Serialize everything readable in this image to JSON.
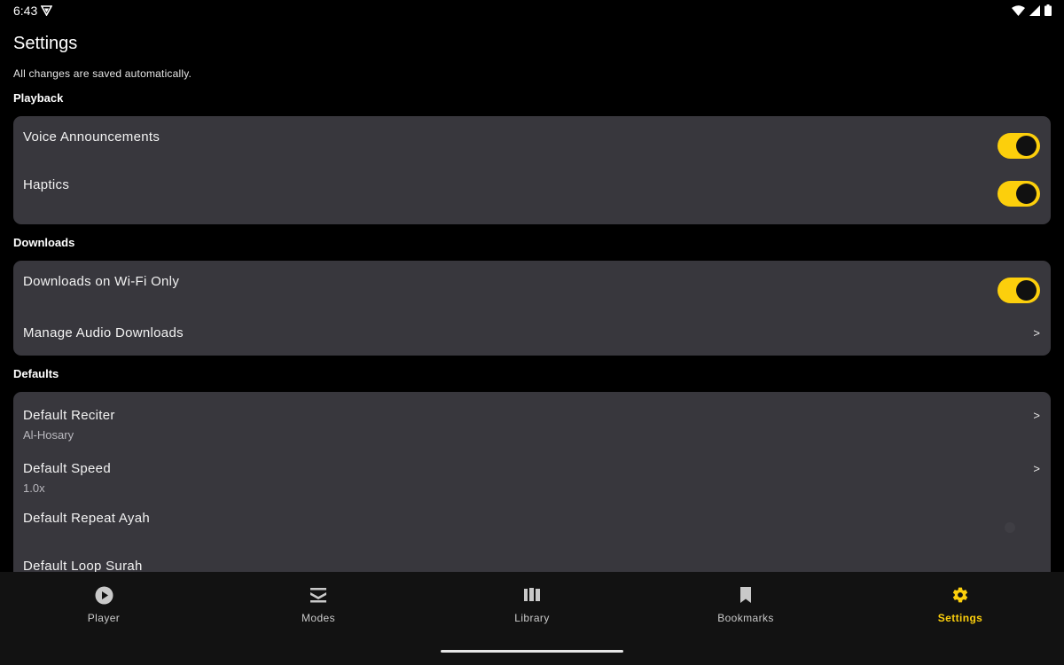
{
  "status_bar": {
    "time": "6:43"
  },
  "header": {
    "title": "Settings",
    "subtitle": "All changes are saved automatically."
  },
  "sections": {
    "playback": {
      "label": "Playback",
      "items": [
        {
          "title": "Voice Announcements",
          "enabled": true
        },
        {
          "title": "Haptics",
          "enabled": true
        }
      ]
    },
    "downloads": {
      "label": "Downloads",
      "items": [
        {
          "title": "Downloads on Wi-Fi Only",
          "enabled": true
        },
        {
          "title": "Manage Audio Downloads",
          "chevron": ">"
        }
      ]
    },
    "defaults": {
      "label": "Defaults",
      "items": [
        {
          "title": "Default Reciter",
          "value": "Al-Hosary",
          "chevron": ">"
        },
        {
          "title": "Default Speed",
          "value": "1.0x",
          "chevron": ">"
        },
        {
          "title": "Default Repeat Ayah",
          "enabled": false
        },
        {
          "title": "Default Loop Surah"
        }
      ]
    }
  },
  "bottom_nav": {
    "items": [
      {
        "label": "Player",
        "icon": "play-circle-icon"
      },
      {
        "label": "Modes",
        "icon": "modes-icon"
      },
      {
        "label": "Library",
        "icon": "library-icon"
      },
      {
        "label": "Bookmarks",
        "icon": "bookmark-icon"
      },
      {
        "label": "Settings",
        "icon": "gear-icon",
        "active": true
      }
    ]
  },
  "colors": {
    "accent": "#fccf0c",
    "background": "#000000",
    "card": "#38373d",
    "nav_background": "#121212"
  }
}
